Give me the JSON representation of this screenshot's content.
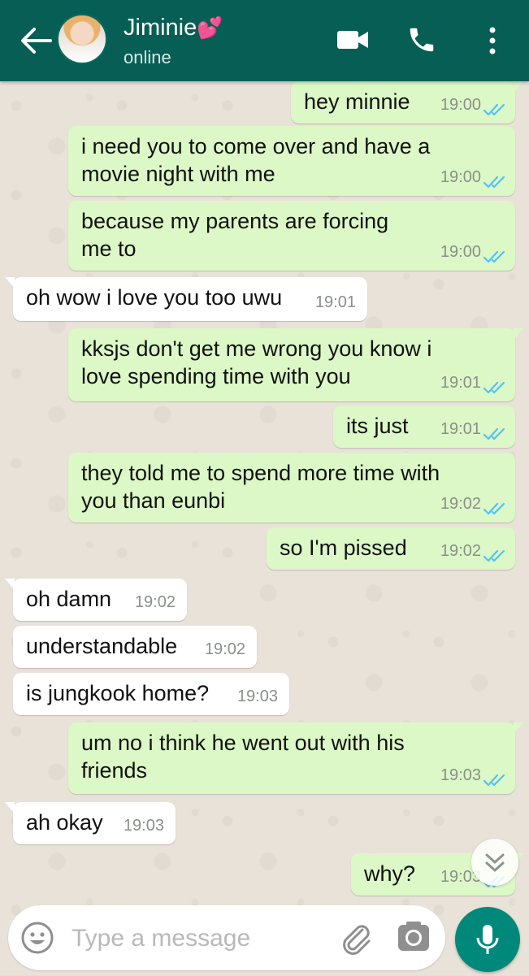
{
  "header": {
    "contact_name": "Jiminie",
    "name_emoji": "💕",
    "status": "online"
  },
  "messages": [
    {
      "dir": "out",
      "lines": [
        "hey minnie"
      ],
      "time": "19:00"
    },
    {
      "dir": "out",
      "lines": [
        "i need you to come over and have a",
        "movie night with me"
      ],
      "time": "19:00"
    },
    {
      "dir": "out",
      "lines": [
        "because my parents are forcing",
        "me to"
      ],
      "time": "19:00"
    },
    {
      "dir": "in",
      "lines": [
        "oh wow i love you too uwu"
      ],
      "time": "19:01"
    },
    {
      "dir": "out",
      "lines": [
        "kksjs don't get me wrong you know i",
        "love spending time with you"
      ],
      "time": "19:01"
    },
    {
      "dir": "out",
      "lines": [
        "its just"
      ],
      "time": "19:01"
    },
    {
      "dir": "out",
      "lines": [
        "they told me to spend more time with",
        "you than eunbi"
      ],
      "time": "19:02"
    },
    {
      "dir": "out",
      "lines": [
        "so I'm pissed"
      ],
      "time": "19:02"
    },
    {
      "dir": "in",
      "lines": [
        "oh damn"
      ],
      "time": "19:02"
    },
    {
      "dir": "in",
      "lines": [
        "understandable"
      ],
      "time": "19:02"
    },
    {
      "dir": "in",
      "lines": [
        "is jungkook home?"
      ],
      "time": "19:03"
    },
    {
      "dir": "out",
      "lines": [
        "um no i think he went out with his",
        "friends"
      ],
      "time": "19:03"
    },
    {
      "dir": "in",
      "lines": [
        "ah okay"
      ],
      "time": "19:03"
    },
    {
      "dir": "out",
      "lines": [
        "why?"
      ],
      "time": "19:03"
    }
  ],
  "input": {
    "placeholder": "Type a message"
  },
  "colors": {
    "header": "#075e54",
    "outgoing_bubble": "#dcf8c6",
    "incoming_bubble": "#ffffff",
    "read_ticks": "#4fc3f7",
    "mic_button": "#00897b"
  },
  "icons": {
    "back": "arrow-left-icon",
    "video": "video-camera-icon",
    "call": "phone-icon",
    "menu": "more-vertical-icon",
    "scroll": "double-chevron-down-icon",
    "emoji": "smiley-icon",
    "attach": "paperclip-icon",
    "camera": "camera-icon",
    "mic": "microphone-icon"
  }
}
